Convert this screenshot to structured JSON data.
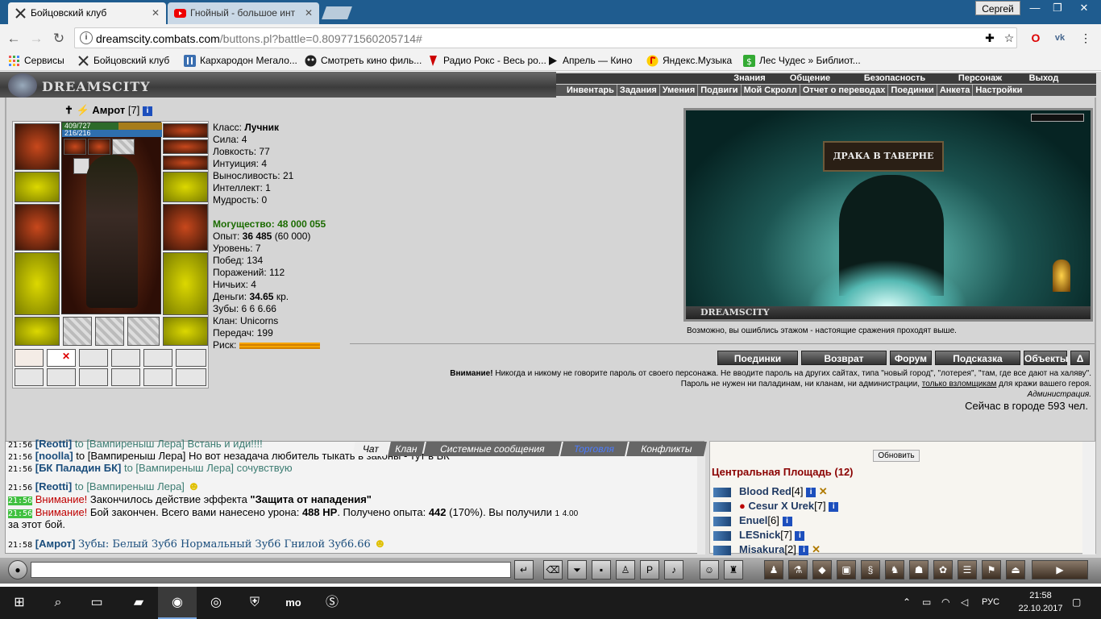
{
  "browser": {
    "tabs": [
      {
        "title": "Бойцовский клуб",
        "active": true
      },
      {
        "title": "Гнойный - большое инт",
        "active": false
      }
    ],
    "user": "Сергей",
    "url_host": "dreamscity.combats.com",
    "url_path": "/buttons.pl?battle=0.809771560205714#",
    "bookmarks": [
      "Сервисы",
      "Бойцовский клуб",
      "Кархародон Мегало...",
      "Смотреть кино филь...",
      "Радио Рокс - Весь ро...",
      "Апрель — Кино",
      "Яндекс.Музыка",
      "Лес Чудес » Библиот..."
    ]
  },
  "game": {
    "logo": "DREAMSCITY",
    "topnav": [
      "Знания",
      "Общение",
      "Безопасность",
      "Персонаж",
      "Выход"
    ],
    "subnav": [
      "Инвентарь",
      "Задания",
      "Умения",
      "Подвиги",
      "Мой Скролл",
      "Отчет о переводах",
      "Поединки",
      "Анкета",
      "Настройки"
    ],
    "character": {
      "name": "Амрот",
      "level": "[7]",
      "hp": "409/727",
      "hp_fraction": 0.5626,
      "mp": "216/216",
      "class_label": "Класс:",
      "class": "Лучник",
      "stats": [
        "Сила: 4",
        "Ловкость: 77",
        "Интуиция: 4",
        "Выносливость: 21",
        "Интеллект: 1",
        "Мудрость: 0"
      ],
      "power_label": "Могущество:",
      "power": "48 000 055",
      "exp_label": "Опыт:",
      "exp": "36 485",
      "exp_next": "(60 000)",
      "info": [
        "Уровень: 7",
        "Побед: 134",
        "Поражений: 112",
        "Ничьих: 4"
      ],
      "money_label": "Деньги:",
      "money": "34.65",
      "money_unit": "кр.",
      "teeth": "Зубы: 6 6 6.66",
      "clan": "Клан: Unicorns",
      "transfers": "Передач: 199",
      "risk_label": "Риск:"
    },
    "scene_caption": "DREAMSCITY",
    "scene_banner": "ДРАКА В ТАВЕРНЕ",
    "floor_msg": "Возможно, вы ошиблись этажом - настоящие сражения проходят выше.",
    "actions": [
      "Поединки",
      "Возврат",
      "Форум",
      "Подсказка",
      "Объекты",
      "Δ"
    ],
    "warning_title": "Внимание!",
    "warning_line1": "Никогда и никому не говорите пароль от своего персонажа. Не вводите пароль на других сайтах, типа \"новый город\", \"лотерея\", \"там, где все дают на халяву\".",
    "warning_line2a": "Пароль не нужен ни паладинам, ни кланам, ни администрации,",
    "warning_line2b": "только взломщикам",
    "warning_line2c": "для кражи вашего героя.",
    "admin": "Администрация.",
    "online": "Сейчас в городе 593 чел."
  },
  "chat": {
    "tabs": [
      "Чат",
      "Клан",
      "Системные сообщения",
      "Торговля",
      "Конфликты"
    ],
    "lines": [
      {
        "time": "21:56",
        "nick": "[Reotti]",
        "text": "to [Вампиреныш Лера] Встань и иди!!!!"
      },
      {
        "time": "21:56",
        "nick": "[noolla]",
        "text": "to [Вампиреныш Лера] Но вот незадача любитель тыкать в законы - тут в БК"
      },
      {
        "time": "21:56",
        "nick": "[БК Паладин БК]",
        "text": "to [Вампиреныш Лера] сочувствую"
      },
      {
        "time": "21:56",
        "nick": "[Reotti]",
        "text": "to [Вампиреныш Лера]"
      }
    ],
    "sys1_time": "21:56",
    "sys1_attn": "Внимание!",
    "sys1_text": "Закончилось действие эффекта",
    "sys1_effect": "\"Защита от нападения\"",
    "sys2_time": "21:56",
    "sys2_attn": "Внимание!",
    "sys2_a": "Бой закончен. Всего вами нанесено урона:",
    "sys2_dmg": "488 HP",
    "sys2_b": ". Получено опыта:",
    "sys2_exp": "442",
    "sys2_c": "(170%). Вы получили",
    "sys2_d": "1",
    "sys2_e": "4.00",
    "sys2_tail": "за этот бой.",
    "last_time": "21:58",
    "last_nick": "[Амрот]",
    "last_text": "Зубы: Белый Зуб6 Нормальный Зуб6 Гнилой Зуб6.66"
  },
  "room": {
    "refresh": "Обновить",
    "title": "Центральная Площадь (12)",
    "players": [
      {
        "name": "Blood Red",
        "level": "[4]",
        "sword": true
      },
      {
        "name": "Cesur X Urek",
        "level": "[7]",
        "sword": false
      },
      {
        "name": "Enuel",
        "level": "[6]",
        "sword": false
      },
      {
        "name": "LESnick",
        "level": "[7]",
        "sword": false
      },
      {
        "name": "Misakura",
        "level": "[2]",
        "sword": true
      }
    ]
  },
  "taskbar": {
    "time": "21:58",
    "date": "22.10.2017",
    "lang": "РУС",
    "apps": [
      "mo"
    ]
  },
  "colors": {
    "tab_bar": "#1f5c8f",
    "power_green": "#1b6b00",
    "alert_red": "#c00000",
    "room_title": "#8a0000"
  }
}
